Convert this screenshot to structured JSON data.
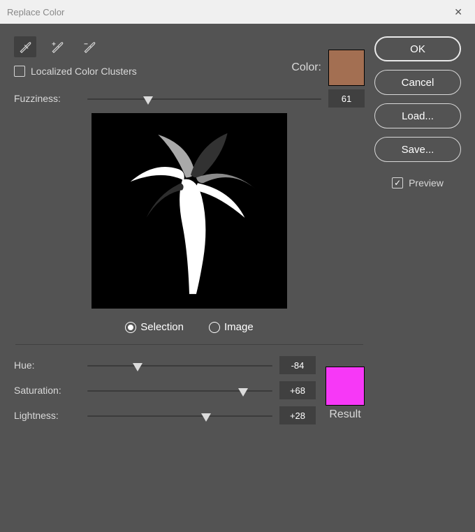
{
  "title": "Replace Color",
  "color_label": "Color:",
  "color_swatch": "#a36f52",
  "localized_clusters_label": "Localized Color Clusters",
  "localized_clusters_checked": false,
  "fuzziness_label": "Fuzziness:",
  "fuzziness_value": "61",
  "fuzziness_pos_percent": 26,
  "display_mode": {
    "selection": "Selection",
    "image": "Image",
    "selected": "selection"
  },
  "hue_label": "Hue:",
  "hue_value": "-84",
  "hue_pos_percent": 27,
  "saturation_label": "Saturation:",
  "saturation_value": "+68",
  "saturation_pos_percent": 84,
  "lightness_label": "Lightness:",
  "lightness_value": "+28",
  "lightness_pos_percent": 64,
  "result_label": "Result",
  "result_swatch": "#f738f7",
  "buttons": {
    "ok": "OK",
    "cancel": "Cancel",
    "load": "Load...",
    "save": "Save..."
  },
  "preview_label": "Preview",
  "preview_checked": true
}
